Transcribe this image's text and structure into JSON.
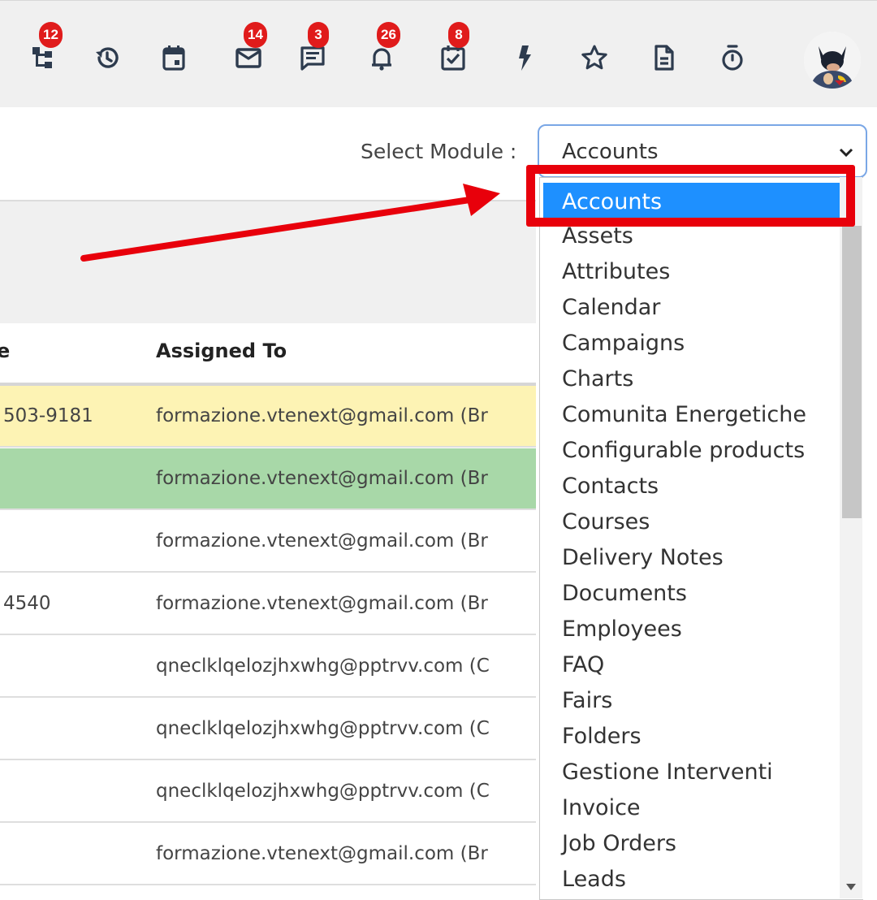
{
  "toolbar": {
    "icons": [
      {
        "name": "org-chart-icon",
        "badge": "12"
      },
      {
        "name": "history-icon",
        "badge": ""
      },
      {
        "name": "calendar-icon",
        "badge": ""
      },
      {
        "name": "mail-icon",
        "badge": "14"
      },
      {
        "name": "chat-icon",
        "badge": "3"
      },
      {
        "name": "bell-icon",
        "badge": "26"
      },
      {
        "name": "tasks-icon",
        "badge": "8"
      },
      {
        "name": "lightning-icon",
        "badge": ""
      },
      {
        "name": "star-icon",
        "badge": ""
      },
      {
        "name": "document-icon",
        "badge": ""
      },
      {
        "name": "timer-icon",
        "badge": ""
      }
    ],
    "avatar_icon": "user-avatar-icon"
  },
  "module_select": {
    "label": "Select Module :",
    "value": "Accounts"
  },
  "list": {
    "partial_header": "e",
    "assigned_header": "Assigned To",
    "rows": [
      {
        "phone": "503-9181",
        "assigned": "formazione.vtenext@gmail.com (Br",
        "color": "#fdf3b4"
      },
      {
        "phone": "",
        "assigned": "formazione.vtenext@gmail.com (Br",
        "color": "#a8d8a8"
      },
      {
        "phone": "",
        "assigned": "formazione.vtenext@gmail.com (Br",
        "color": "#ffffff"
      },
      {
        "phone": "4540",
        "assigned": "formazione.vtenext@gmail.com (Br",
        "color": "#ffffff"
      },
      {
        "phone": "",
        "assigned": "qneclklqelozjhxwhg@pptrvv.com (C",
        "color": "#ffffff"
      },
      {
        "phone": "",
        "assigned": "qneclklqelozjhxwhg@pptrvv.com (C",
        "color": "#ffffff"
      },
      {
        "phone": "",
        "assigned": "qneclklqelozjhxwhg@pptrvv.com (C",
        "color": "#ffffff"
      },
      {
        "phone": "",
        "assigned": "formazione.vtenext@gmail.com (Br",
        "color": "#ffffff"
      }
    ]
  },
  "dropdown": {
    "selected": "Accounts",
    "items": [
      "Assets",
      "Attributes",
      "Calendar",
      "Campaigns",
      "Charts",
      "Comunita Energetiche",
      "Configurable products",
      "Contacts",
      "Courses",
      "Delivery Notes",
      "Documents",
      "Employees",
      "FAQ",
      "Fairs",
      "Folders",
      "Gestione Interventi",
      "Invoice",
      "Job Orders",
      "Leads"
    ]
  },
  "colors": {
    "accent": "#1e90ff",
    "annotation": "#e8000b",
    "badge": "#e01b1b"
  }
}
